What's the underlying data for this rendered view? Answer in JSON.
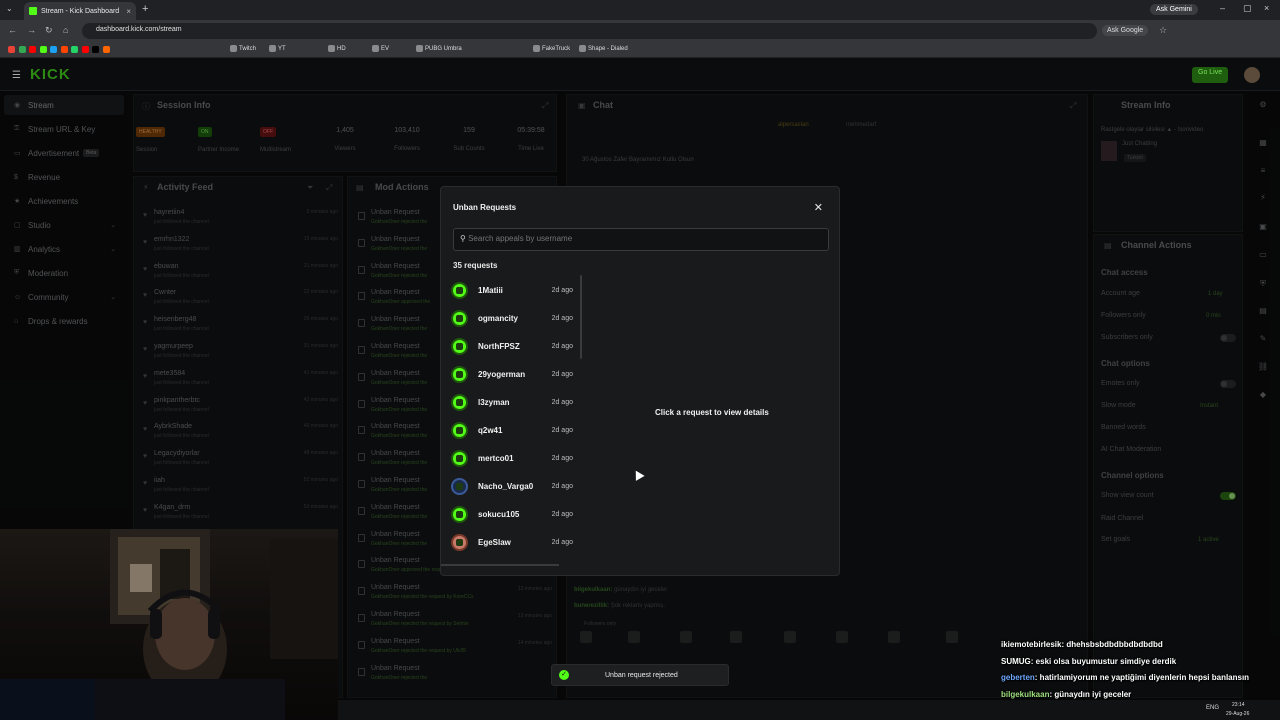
{
  "browser": {
    "tab_title": "Stream - Kick Dashboard",
    "url": "dashboard.kick.com/stream",
    "ask_gemini": "Ask Gemini",
    "ask_google": "Ask Google",
    "bookmarks": [
      "Twitch",
      "YT",
      "HD",
      "EV",
      "PUBG Umbra",
      "FakeTruck",
      "Shape - Dialed"
    ]
  },
  "app": {
    "logo": "KICK",
    "go_live": "Go Live"
  },
  "sidebar": {
    "items": [
      {
        "label": "Stream",
        "icon": "stream-icon"
      },
      {
        "label": "Stream URL & Key",
        "icon": "key-icon"
      },
      {
        "label": "Advertisement",
        "icon": "ad-icon",
        "badge": "Beta"
      },
      {
        "label": "Revenue",
        "icon": "dollar-icon"
      },
      {
        "label": "Achievements",
        "icon": "trophy-icon"
      },
      {
        "label": "Studio",
        "icon": "studio-icon"
      },
      {
        "label": "Analytics",
        "icon": "chart-icon"
      },
      {
        "label": "Moderation",
        "icon": "shield-icon"
      },
      {
        "label": "Community",
        "icon": "people-icon"
      },
      {
        "label": "Drops & rewards",
        "icon": "gift-icon"
      }
    ]
  },
  "session": {
    "title": "Session Info",
    "stats": [
      {
        "badge": "HEALTHY",
        "label": "Session"
      },
      {
        "badge": "ON",
        "label": "Partner Income"
      },
      {
        "badge": "OFF",
        "label": "Multistream"
      },
      {
        "value": "1,405",
        "label": "Viewers"
      },
      {
        "value": "103,410",
        "label": "Followers"
      },
      {
        "value": "159",
        "label": "Sub Counts"
      },
      {
        "value": "05:39:58",
        "label": "Time Live"
      }
    ]
  },
  "activity": {
    "title": "Activity Feed",
    "sub": "just followed the channel",
    "rows": [
      {
        "user": "hayretiin4",
        "time": "5 minutes ago"
      },
      {
        "user": "emrhn1322",
        "time": "15 minutes ago"
      },
      {
        "user": "ebuwan",
        "time": "21 minutes ago"
      },
      {
        "user": "Cwnter",
        "time": "22 minutes ago"
      },
      {
        "user": "heisenberg48",
        "time": "26 minutes ago"
      },
      {
        "user": "yagmurpeep",
        "time": "31 minutes ago"
      },
      {
        "user": "mete3584",
        "time": "41 minutes ago"
      },
      {
        "user": "pinkpantherbtc",
        "time": "42 minutes ago"
      },
      {
        "user": "AybrkShade",
        "time": "46 minutes ago"
      },
      {
        "user": "Legacydiyorlar",
        "time": "48 minutes ago"
      },
      {
        "user": "iiah",
        "time": "52 minutes ago"
      },
      {
        "user": "K4gan_drm",
        "time": "53 minutes ago"
      }
    ]
  },
  "mod": {
    "title": "Mod Actions",
    "rows": [
      {
        "title": "Unban Request",
        "sub": "GokhanOner rejected the"
      },
      {
        "title": "Unban Request",
        "sub": "GokhanOner rejected the"
      },
      {
        "title": "Unban Request",
        "sub": "GokhanOner rejected the"
      },
      {
        "title": "Unban Request",
        "sub": "GokhanOner approved the"
      },
      {
        "title": "Unban Request",
        "sub": "GokhanOner rejected the"
      },
      {
        "title": "Unban Request",
        "sub": "GokhanOner rejected the"
      },
      {
        "title": "Unban Request",
        "sub": "GokhanOner rejected the"
      },
      {
        "title": "Unban Request",
        "sub": "GokhanOner rejected the"
      },
      {
        "title": "Unban Request",
        "sub": "GokhanOner rejected the"
      },
      {
        "title": "Unban Request",
        "sub": "GokhanOner rejected the"
      },
      {
        "title": "Unban Request",
        "sub": "GokhanOner rejected the"
      },
      {
        "title": "Unban Request",
        "sub": "GokhanOner rejected the"
      },
      {
        "title": "Unban Request",
        "sub": "GokhanOner rejected the"
      },
      {
        "title": "Unban Request",
        "sub": "GokhanOner approved the request by yoshidumi",
        "meta": "12 minutes ago"
      },
      {
        "title": "Unban Request",
        "sub": "GokhanOner rejected the request by KoreCCs",
        "meta": "13 minutes ago"
      },
      {
        "title": "Unban Request",
        "sub": "GokhanOner rejected the request by Selmin",
        "meta": "13 minutes ago"
      },
      {
        "title": "Unban Request",
        "sub": "GokhanOner rejected the request by Ulv35",
        "meta": "14 minutes ago"
      },
      {
        "title": "Unban Request",
        "sub": "GokhanOner rejected the",
        "meta": ""
      }
    ]
  },
  "chat": {
    "title": "Chat",
    "pinned_users": [
      "alpersaslan",
      "mehmedarf"
    ],
    "pinned_msg": "30 Ağustos Zafer Bayramımız Kutlu Olsun",
    "lines": [
      {
        "user": "bilgekulkaan:",
        "text": "günaydın iyi geceler"
      },
      {
        "user": "bunerezillik:",
        "text": "Şok reklamı yapmış."
      }
    ],
    "followers_only": "Followers only"
  },
  "stream_info": {
    "title": "Stream Info",
    "stream_title": "Rastgele olaylar silsilesi ▲ - !sonvideo",
    "category": "Just Chatting",
    "language": "Turkish"
  },
  "channel_actions": {
    "title": "Channel Actions",
    "chat_access": "Chat access",
    "account_age": "Account age",
    "account_age_val": "1 day",
    "followers_only": "Followers only",
    "followers_only_val": "0 min",
    "subscribers_only": "Subscribers only",
    "chat_options": "Chat options",
    "emotes_only": "Emotes only",
    "slow_mode": "Slow mode",
    "slow_mode_val": "Instant",
    "banned_words": "Banned words",
    "ai_mod": "AI Chat Moderation",
    "channel_options": "Channel options",
    "show_view_count": "Show view count",
    "raid_channel": "Raid Channel",
    "set_goals": "Set goals",
    "set_goals_val": "1 active"
  },
  "modal": {
    "title": "Unban Requests",
    "search_placeholder": "Search appeals by username",
    "count": "35 requests",
    "detail_hint": "Click a request to view details",
    "requests": [
      {
        "name": "1Matiii",
        "ago": "2d ago"
      },
      {
        "name": "ogmancity",
        "ago": "2d ago"
      },
      {
        "name": "NorthFPSZ",
        "ago": "2d ago"
      },
      {
        "name": "29yogerman",
        "ago": "2d ago"
      },
      {
        "name": "l3zyman",
        "ago": "2d ago"
      },
      {
        "name": "q2w41",
        "ago": "2d ago"
      },
      {
        "name": "mertco01",
        "ago": "2d ago"
      },
      {
        "name": "Nacho_Varga0",
        "ago": "2d ago"
      },
      {
        "name": "sokucu105",
        "ago": "2d ago"
      },
      {
        "name": "EgeSlaw",
        "ago": "2d ago"
      }
    ]
  },
  "toast": {
    "text": "Unban request rejected"
  },
  "overlay_chat": [
    {
      "user": "ikiemotebirlesik",
      "text": ": dhehsbsbdbdbbdbdbdbd",
      "color": "#ffffff"
    },
    {
      "user": "SUMUG",
      "text": ": eski olsa buyumustur simdiye derdik",
      "color": "#ffffff"
    },
    {
      "user": "geberten",
      "text": ": hatirlamiyorum ne yaptiğimi diyenlerin hepsi banlansın",
      "color": "#6fa8ff"
    },
    {
      "user": "bilgekulkaan",
      "text": ": günaydın iyi geceler",
      "color": "#9fe07f"
    },
    {
      "user": "bunerezillik",
      "text": ": Şok reklamı yapmış.",
      "color": "#c9a0ff"
    }
  ],
  "taskbar": {
    "lang": "ENG",
    "time": "23:14",
    "date": "29-Aug-26"
  },
  "colors": {
    "kick_green": "#53fc18",
    "panel": "#121314",
    "modal": "#191a1b"
  }
}
